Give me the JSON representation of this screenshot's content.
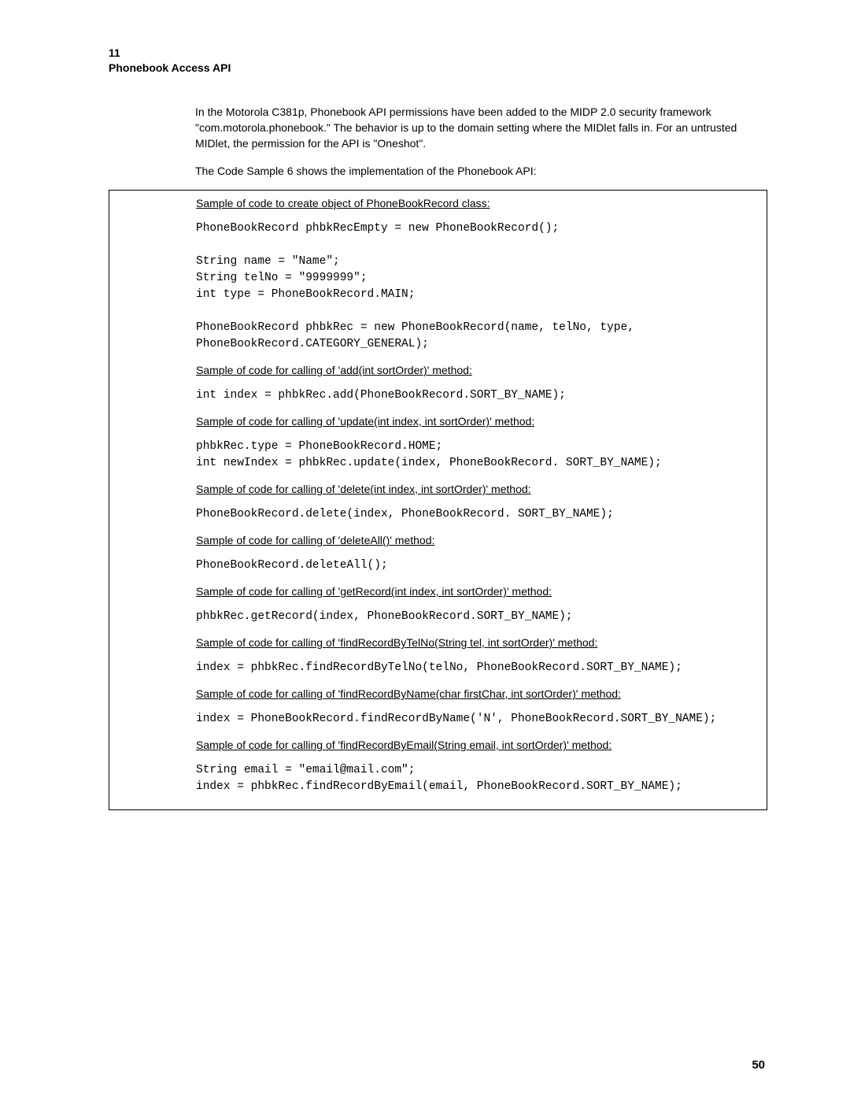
{
  "header_line1": "11",
  "header_line2": "Phonebook Access API",
  "intro_p1": "In the Motorola C381p, Phonebook API permissions have been added to the MIDP 2.0 security framework \"com.motorola.phonebook.\" The behavior is up to the domain setting where the MIDlet falls in. For an untrusted MIDlet, the permission for the API is \"Oneshot\".",
  "intro_p2": "The Code Sample 6 shows the implementation of the Phonebook API:",
  "sections": [
    {
      "label": "Sample of code to create object of PhoneBookRecord class:",
      "code": "PhoneBookRecord phbkRecEmpty = new PhoneBookRecord();\n\nString name = \"Name\";\nString telNo = \"9999999\";\nint type = PhoneBookRecord.MAIN;\n\nPhoneBookRecord phbkRec = new PhoneBookRecord(name, telNo, type, PhoneBookRecord.CATEGORY_GENERAL);"
    },
    {
      "label": "Sample of code for calling of 'add(int sortOrder)' method:",
      "code": "int index = phbkRec.add(PhoneBookRecord.SORT_BY_NAME);"
    },
    {
      "label": "Sample of code for calling of 'update(int index, int sortOrder)' method:",
      "code": "phbkRec.type = PhoneBookRecord.HOME;\nint newIndex = phbkRec.update(index, PhoneBookRecord. SORT_BY_NAME);"
    },
    {
      "label": "Sample of code for calling of 'delete(int index, int sortOrder)' method:",
      "code": "PhoneBookRecord.delete(index, PhoneBookRecord. SORT_BY_NAME);"
    },
    {
      "label": "Sample of code for calling of 'deleteAll()' method:",
      "code": "PhoneBookRecord.deleteAll();"
    },
    {
      "label": "Sample of code for calling of 'getRecord(int index, int sortOrder)' method:",
      "code": "phbkRec.getRecord(index, PhoneBookRecord.SORT_BY_NAME);"
    },
    {
      "label": "Sample of code for calling of 'findRecordByTelNo(String tel, int sortOrder)' method:",
      "code": "index = phbkRec.findRecordByTelNo(telNo, PhoneBookRecord.SORT_BY_NAME);"
    },
    {
      "label": "Sample of code for calling of 'findRecordByName(char firstChar, int sortOrder)' method:",
      "code": "index = PhoneBookRecord.findRecordByName('N', PhoneBookRecord.SORT_BY_NAME);"
    },
    {
      "label": "Sample of code for calling of 'findRecordByEmail(String email, int sortOrder)' method:",
      "code": "String email = \"email@mail.com\";\nindex = phbkRec.findRecordByEmail(email, PhoneBookRecord.SORT_BY_NAME);"
    }
  ],
  "page_number": "50"
}
